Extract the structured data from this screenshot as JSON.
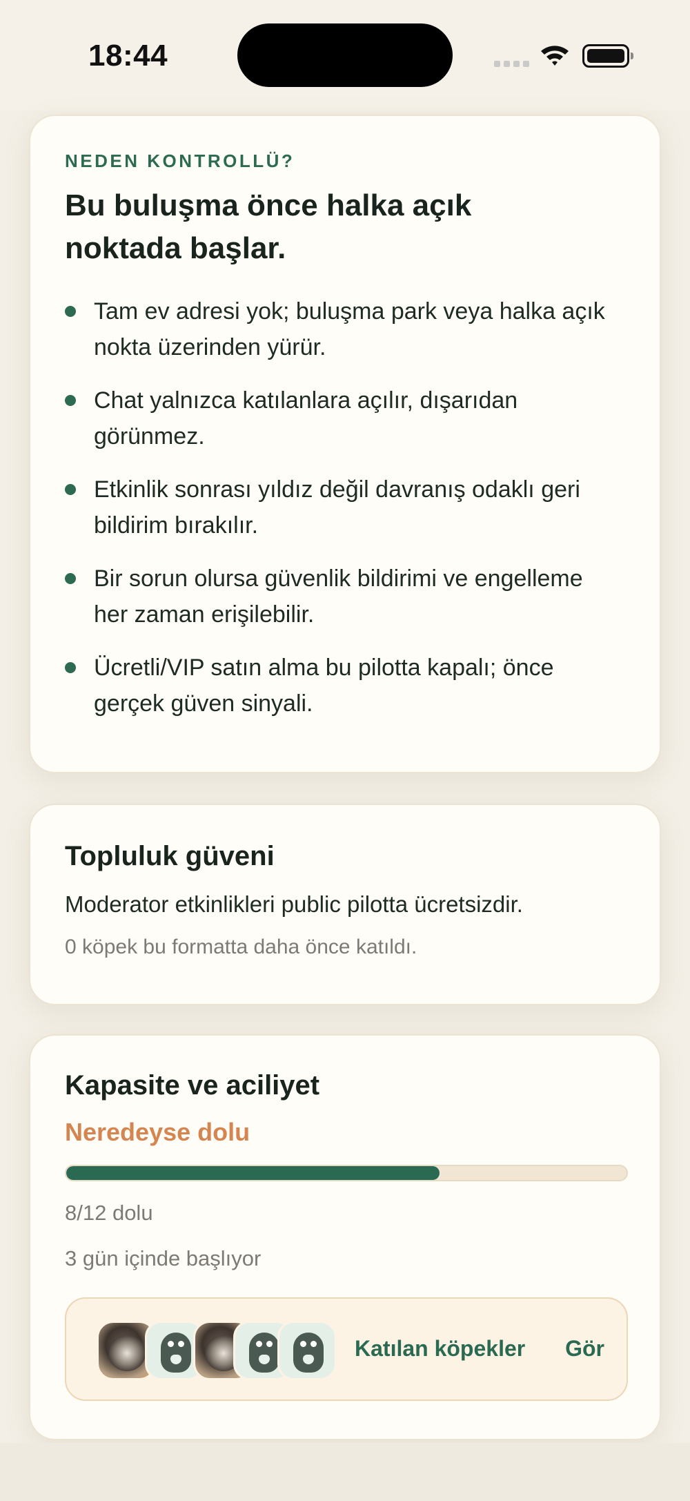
{
  "status_bar": {
    "time": "18:44"
  },
  "safety": {
    "eyebrow": "NEDEN KONTROLLÜ?",
    "title": "Bu buluşma önce halka açık noktada başlar.",
    "rules": [
      "Tam ev adresi yok; buluşma park veya halka açık nokta üzerinden yürür.",
      "Chat yalnızca katılanlara açılır, dışarıdan görünmez.",
      "Etkinlik sonrası yıldız değil davranış odaklı geri bildirim bırakılır.",
      "Bir sorun olursa güvenlik bildirimi ve engelleme her zaman erişilebilir.",
      "Ücretli/VIP satın alma bu pilotta kapalı; önce gerçek güven sinyali."
    ]
  },
  "trust": {
    "title": "Topluluk güveni",
    "line": "Moderator etkinlikleri public pilotta ücretsizdir.",
    "sub": "0 köpek bu formatta daha önce katıldı."
  },
  "capacity": {
    "title": "Kapasite ve aciliyet",
    "urgency": "Neredeyse dolu",
    "filled": 8,
    "total": 12,
    "count_text": "8/12 dolu",
    "starts_in": "3 gün içinde başlıyor",
    "attendees_label": "Katılan köpekler",
    "see_label": "Gör",
    "avatars": [
      "dog-photo",
      "mascot",
      "dog-photo",
      "mascot",
      "mascot"
    ]
  },
  "colors": {
    "accent_green": "#2b6a52",
    "urgency_orange": "#d48550",
    "card_bg": "#fffdf8",
    "page_bg": "#f3efe6"
  }
}
